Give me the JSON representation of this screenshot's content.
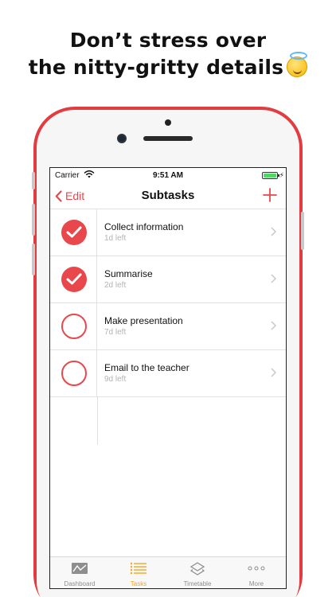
{
  "headline": {
    "line1": "Don’t stress over",
    "line2": "the nitty-gritty details"
  },
  "status_bar": {
    "carrier": "Carrier",
    "time": "9:51 AM",
    "bolt": "⚡"
  },
  "nav": {
    "back_label": "Edit",
    "title": "Subtasks",
    "add_icon": "plus-icon"
  },
  "subtasks": [
    {
      "title": "Collect information",
      "due": "1d left",
      "completed": true
    },
    {
      "title": "Summarise",
      "due": "2d left",
      "completed": true
    },
    {
      "title": "Make presentation",
      "due": "7d left",
      "completed": false
    },
    {
      "title": "Email to the teacher",
      "due": "9d left",
      "completed": false
    }
  ],
  "tabs": [
    {
      "label": "Dashboard",
      "icon": "chart-icon",
      "active": false
    },
    {
      "label": "Tasks",
      "icon": "list-icon",
      "active": true
    },
    {
      "label": "Timetable",
      "icon": "layers-icon",
      "active": false
    },
    {
      "label": "More",
      "icon": "ellipsis-icon",
      "active": false
    }
  ],
  "colors": {
    "accent": "#e8474c",
    "tab_active": "#f5a623",
    "phone_body": "#e23b40"
  }
}
